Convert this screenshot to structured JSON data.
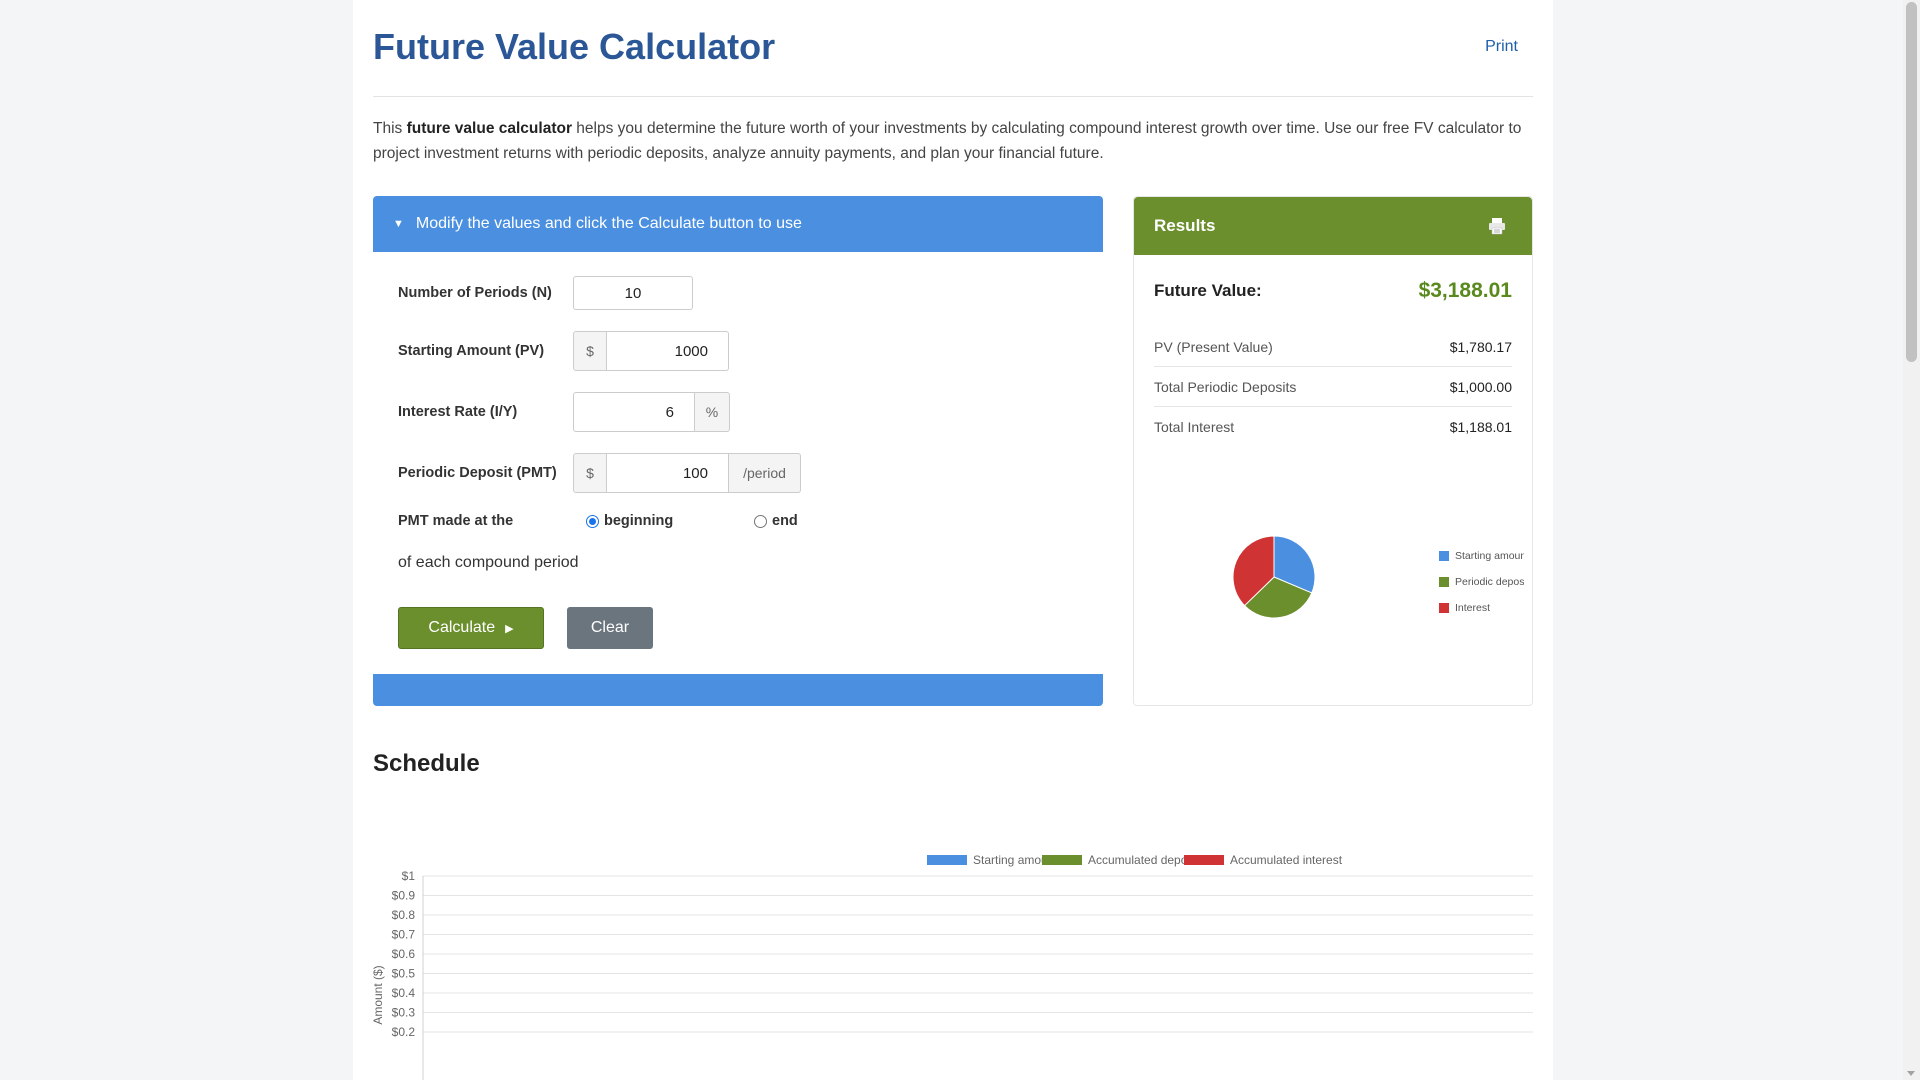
{
  "header": {
    "title": "Future Value Calculator",
    "print_label": "Print"
  },
  "intro": {
    "prefix": "This ",
    "bold": "future value calculator",
    "suffix": " helps you determine the future worth of your investments by calculating compound interest growth over time. Use our free FV calculator to project investment returns with periodic deposits, analyze annuity payments, and plan your financial future."
  },
  "form": {
    "toggle_label": "Modify the values and click the Calculate button to use",
    "periods": {
      "label": "Number of Periods (N)",
      "value": "10"
    },
    "start": {
      "label": "Starting Amount (PV)",
      "prefix": "$",
      "value": "1000"
    },
    "rate": {
      "label": "Interest Rate (I/Y)",
      "value": "6",
      "suffix": "%"
    },
    "pmt": {
      "label": "Periodic Deposit (PMT)",
      "prefix": "$",
      "value": "100",
      "suffix": "/period"
    },
    "timing": {
      "label": "PMT made at the",
      "opt_begin": "beginning",
      "opt_end": "end",
      "selected": "beginning"
    },
    "each_text": "of each compound period",
    "calculate_label": "Calculate",
    "clear_label": "Clear"
  },
  "results": {
    "title": "Results",
    "fv_label": "Future Value:",
    "fv_value": "$3,188.01",
    "lines": [
      {
        "label": "PV (Present Value)",
        "value": "$1,780.17"
      },
      {
        "label": "Total Periodic Deposits",
        "value": "$1,000.00"
      },
      {
        "label": "Total Interest",
        "value": "$1,188.01"
      }
    ]
  },
  "pie": {
    "legend": [
      "Starting amount",
      "Periodic deposits",
      "Interest"
    ],
    "colors": [
      "#4a8fe0",
      "#6a8f2c",
      "#d03333"
    ]
  },
  "schedule": {
    "title": "Schedule"
  },
  "chart_data": [
    {
      "type": "pie",
      "labels": [
        "Starting amount",
        "Periodic deposits",
        "Interest"
      ],
      "values": [
        1000,
        1000,
        1188.01
      ]
    },
    {
      "type": "bar",
      "series": [
        {
          "name": "Starting amount",
          "color": "#4a8fe0",
          "values": []
        },
        {
          "name": "Accumulated deposits",
          "color": "#6a8f2c",
          "values": []
        },
        {
          "name": "Accumulated interest",
          "color": "#d03333",
          "values": []
        }
      ],
      "ylabel": "Amount ($)",
      "yticks": [
        "$1",
        "$0.9",
        "$0.8",
        "$0.7",
        "$0.6",
        "$0.5",
        "$0.4",
        "$0.3",
        "$0.2"
      ],
      "ylim": [
        0,
        1
      ],
      "legend": "top-right"
    }
  ]
}
